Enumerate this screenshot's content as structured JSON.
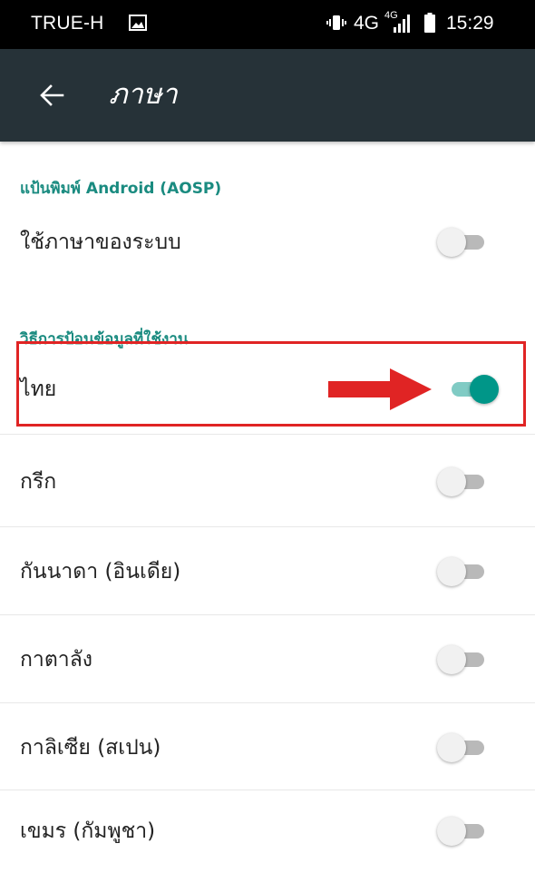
{
  "status_bar": {
    "carrier": "TRUE-H",
    "network": "4G",
    "network_sup": "4G",
    "time": "15:29",
    "icons": [
      "photo-icon",
      "vibrate-icon",
      "signal-icon",
      "battery-icon"
    ]
  },
  "app_bar": {
    "title": "ภาษา",
    "back_icon": "arrow-left-icon",
    "background": "#263238"
  },
  "sections": {
    "keyboard_header": "แป้นพิมพ์ Android (AOSP)",
    "input_methods_header": "วิธีการป้อนข้อมูลที่ใช้งาน"
  },
  "rows": {
    "system_language": {
      "label": "ใช้ภาษาของระบบ",
      "enabled": false
    },
    "thai": {
      "label": "ไทย",
      "enabled": true
    },
    "greek": {
      "label": "กรีก",
      "enabled": false
    },
    "kannada": {
      "label": "กันนาดา (อินเดีย)",
      "enabled": false
    },
    "catalan": {
      "label": "กาตาลัง",
      "enabled": false
    },
    "galician": {
      "label": "กาลิเซีย (สเปน)",
      "enabled": false
    },
    "khmer": {
      "label": "เขมร (กัมพูชา)",
      "enabled": false
    }
  },
  "colors": {
    "accent": "#009688",
    "accent_light": "#80cbc4",
    "section_header": "#1a8b80",
    "annotation": "#e02424"
  }
}
